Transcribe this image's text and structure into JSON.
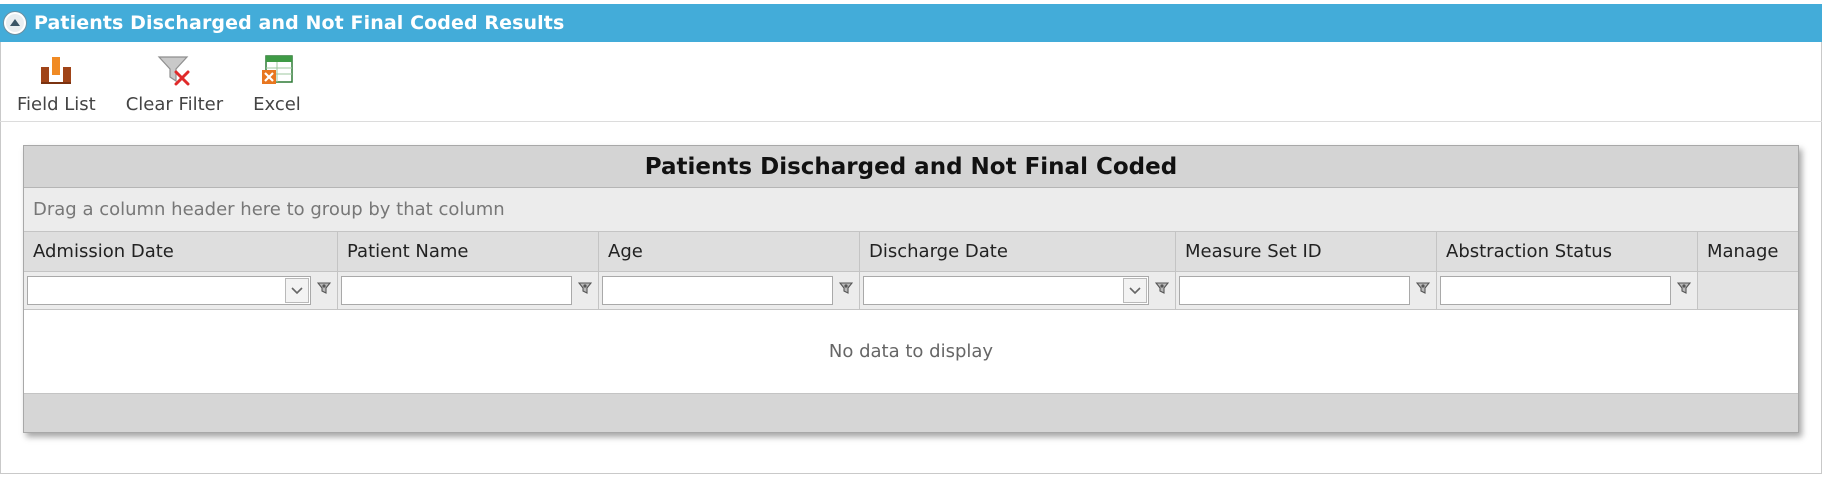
{
  "panel": {
    "title": "Patients Discharged and Not Final Coded Results",
    "collapse_icon": "collapse-up-icon"
  },
  "toolbar": {
    "items": [
      {
        "label": "Field List",
        "icon": "field-list-icon"
      },
      {
        "label": "Clear Filter",
        "icon": "clear-filter-icon"
      },
      {
        "label": "Excel",
        "icon": "excel-export-icon"
      }
    ]
  },
  "grid": {
    "title": "Patients Discharged and Not Final Coded",
    "group_hint": "Drag a column header here to group by that column",
    "columns": [
      {
        "label": "Admission Date",
        "filter": "dropdown"
      },
      {
        "label": "Patient Name",
        "filter": "text"
      },
      {
        "label": "Age",
        "filter": "text"
      },
      {
        "label": "Discharge Date",
        "filter": "dropdown"
      },
      {
        "label": "Measure Set ID",
        "filter": "text"
      },
      {
        "label": "Abstraction Status",
        "filter": "text"
      },
      {
        "label": "Manage",
        "filter": "none"
      }
    ],
    "empty_message": "No data to display"
  },
  "colors": {
    "titlebar": "#43acd9",
    "grid_title_bg": "#d4d4d4",
    "header_bg": "#dedede"
  }
}
